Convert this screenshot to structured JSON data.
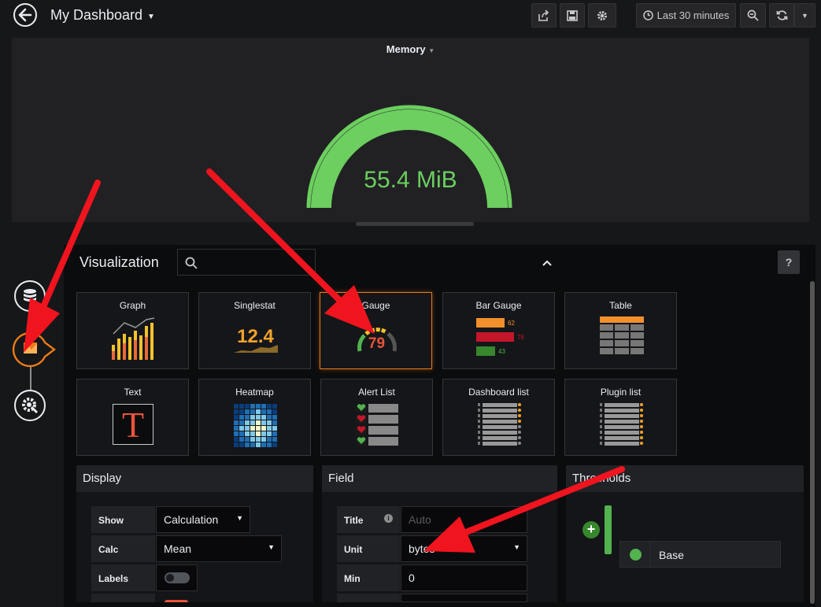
{
  "header": {
    "title": "My Dashboard",
    "time_range": "Last 30 minutes"
  },
  "panel": {
    "title": "Memory",
    "value": "55.4 MiB",
    "gauge_color": "#6ccf5f"
  },
  "visualization": {
    "heading": "Visualization",
    "search_placeholder": "",
    "help_label": "?",
    "tiles": [
      {
        "name": "Graph"
      },
      {
        "name": "Singlestat",
        "preview": "12.4"
      },
      {
        "name": "Gauge",
        "preview": "79",
        "selected": true
      },
      {
        "name": "Bar Gauge",
        "preview_values": [
          "62",
          "76",
          "43"
        ]
      },
      {
        "name": "Table"
      },
      {
        "name": "Text",
        "preview": "T"
      },
      {
        "name": "Heatmap"
      },
      {
        "name": "Alert List"
      },
      {
        "name": "Dashboard list"
      },
      {
        "name": "Plugin list"
      }
    ]
  },
  "display": {
    "title": "Display",
    "show_label": "Show",
    "show_value": "Calculation",
    "calc_label": "Calc",
    "calc_value": "Mean",
    "labels_label": "Labels"
  },
  "field": {
    "title": "Field",
    "title_label": "Title",
    "title_placeholder": "Auto",
    "unit_label": "Unit",
    "unit_value": "bytes",
    "min_label": "Min",
    "min_value": "0"
  },
  "thresholds": {
    "title": "Thresholds",
    "base_label": "Base",
    "base_color": "#52b34e"
  },
  "colors": {
    "accent_orange": "#eb7b18",
    "annotation_red": "#f0141e"
  }
}
